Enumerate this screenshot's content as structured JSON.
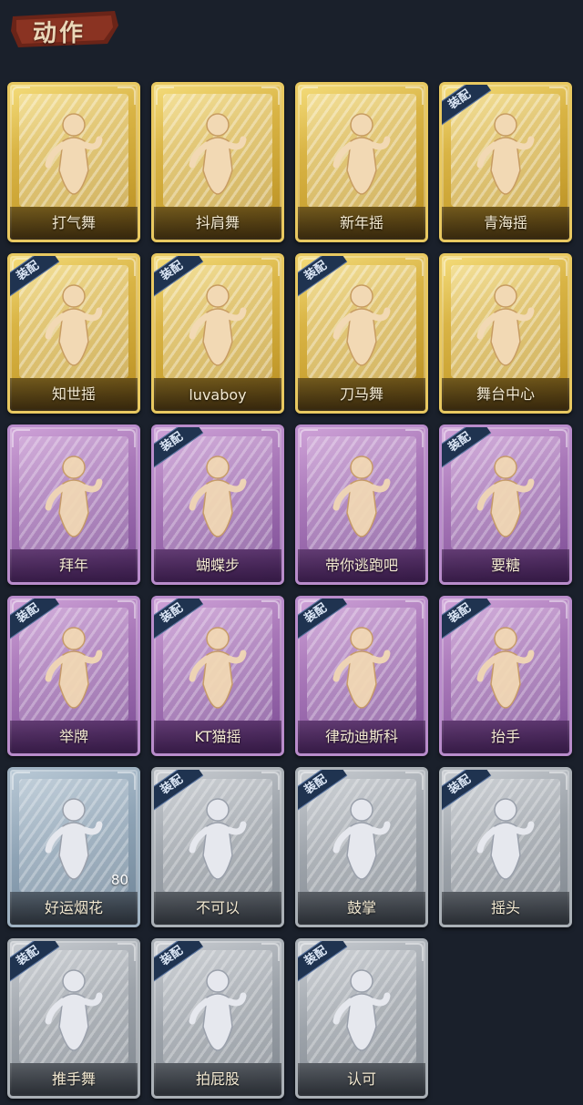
{
  "header": {
    "title": "动作"
  },
  "equip_label": "装配",
  "colors": {
    "gold": "#d9b445",
    "purple": "#a877b8",
    "gray": "#9da3aa",
    "blue": "#8ea3b5"
  },
  "cards": [
    {
      "name": "打气舞",
      "rarity": "gold",
      "equipped": false,
      "icon": "cheer-dance-figure-icon"
    },
    {
      "name": "抖肩舞",
      "rarity": "gold",
      "equipped": false,
      "icon": "shoulder-shake-figure-icon"
    },
    {
      "name": "新年摇",
      "rarity": "gold",
      "equipped": false,
      "icon": "new-year-sway-figure-icon"
    },
    {
      "name": "青海摇",
      "rarity": "gold",
      "equipped": true,
      "icon": "qinghai-sway-figure-icon"
    },
    {
      "name": "知世摇",
      "rarity": "gold",
      "equipped": true,
      "icon": "zhishi-sway-figure-icon"
    },
    {
      "name": "luvaboy",
      "rarity": "gold",
      "equipped": true,
      "icon": "luvaboy-figure-icon"
    },
    {
      "name": "刀马舞",
      "rarity": "gold",
      "equipped": true,
      "icon": "horse-dance-figure-icon"
    },
    {
      "name": "舞台中心",
      "rarity": "gold",
      "equipped": false,
      "icon": "stage-center-figure-icon"
    },
    {
      "name": "拜年",
      "rarity": "purple",
      "equipped": false,
      "icon": "new-year-greeting-figure-icon"
    },
    {
      "name": "蝴蝶步",
      "rarity": "purple",
      "equipped": true,
      "icon": "butterfly-step-figure-icon"
    },
    {
      "name": "带你逃跑吧",
      "rarity": "purple",
      "equipped": false,
      "icon": "run-away-figure-icon"
    },
    {
      "name": "要糖",
      "rarity": "purple",
      "equipped": true,
      "icon": "ask-candy-figure-icon"
    },
    {
      "name": "举牌",
      "rarity": "purple",
      "equipped": true,
      "icon": "hold-sign-figure-icon"
    },
    {
      "name": "KT猫摇",
      "rarity": "purple",
      "equipped": true,
      "icon": "kt-cat-sway-figure-icon"
    },
    {
      "name": "律动迪斯科",
      "rarity": "purple",
      "equipped": true,
      "icon": "disco-figure-icon"
    },
    {
      "name": "抬手",
      "rarity": "purple",
      "equipped": true,
      "icon": "raise-hand-figure-icon"
    },
    {
      "name": "好运烟花",
      "rarity": "blue",
      "equipped": false,
      "icon": "firework-can-icon",
      "count": "80"
    },
    {
      "name": "不可以",
      "rarity": "gray",
      "equipped": true,
      "icon": "finger-wag-icon"
    },
    {
      "name": "鼓掌",
      "rarity": "gray",
      "equipped": true,
      "icon": "clap-hands-icon"
    },
    {
      "name": "摇头",
      "rarity": "gray",
      "equipped": true,
      "icon": "head-shake-figure-icon"
    },
    {
      "name": "推手舞",
      "rarity": "gray",
      "equipped": true,
      "icon": "push-hand-dance-figure-icon"
    },
    {
      "name": "拍屁股",
      "rarity": "gray",
      "equipped": true,
      "icon": "slap-butt-figure-icon"
    },
    {
      "name": "认可",
      "rarity": "gray",
      "equipped": true,
      "icon": "thumbs-up-icon"
    }
  ]
}
